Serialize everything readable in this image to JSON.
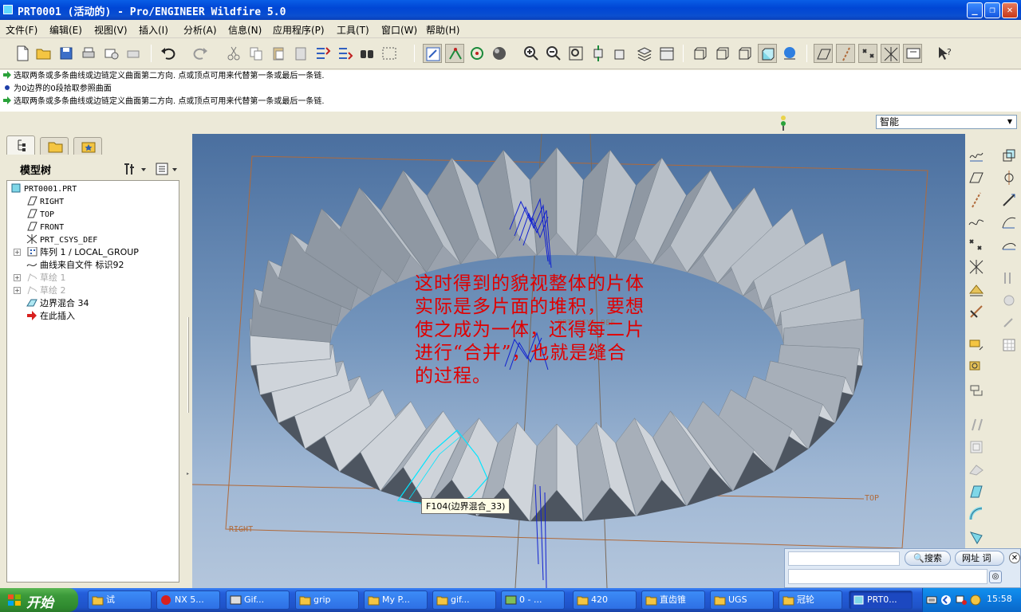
{
  "window": {
    "title": "PRT0001 (活动的) - Pro/ENGINEER Wildfire 5.0",
    "minimize": "_",
    "restore": "❐",
    "close": "✕"
  },
  "menu": [
    "文件(F)",
    "编辑(E)",
    "视图(V)",
    "插入(I)",
    "分析(A)",
    "信息(N)",
    "应用程序(P)",
    "工具(T)",
    "窗口(W)",
    "帮助(H)"
  ],
  "messages": [
    "选取两条或多条曲线或边链定义曲面第二方向. 点或顶点可用来代替第一条或最后一条链.",
    "为0边界的0段拾取参照曲面",
    "选取两条或多条曲线或边链定义曲面第二方向. 点或顶点可用来代替第一条或最后一条链."
  ],
  "filter": {
    "selected": "智能"
  },
  "model_tree": {
    "title": "模型树",
    "items": [
      {
        "label": "PRT0001.PRT",
        "icon": "part-icon"
      },
      {
        "label": "RIGHT",
        "icon": "datum-plane-icon"
      },
      {
        "label": "TOP",
        "icon": "datum-plane-icon"
      },
      {
        "label": "FRONT",
        "icon": "datum-plane-icon"
      },
      {
        "label": "PRT_CSYS_DEF",
        "icon": "csys-icon"
      },
      {
        "label": "阵列 1 / LOCAL_GROUP",
        "icon": "pattern-icon"
      },
      {
        "label": "曲线来自文件 标识92",
        "icon": "curve-icon"
      },
      {
        "label": "草绘 1",
        "icon": "sketch-icon"
      },
      {
        "label": "草绘 2",
        "icon": "sketch-icon"
      },
      {
        "label": "边界混合 34",
        "icon": "boundary-blend-icon"
      },
      {
        "label": "在此插入",
        "icon": "insert-here-icon"
      }
    ]
  },
  "viewport": {
    "annotation": [
      "这时得到的貌视整体的片体",
      "实际是多片面的堆积，要想",
      "使之成为一体，还得每二片",
      "进行“合并”，也就是缝合",
      "的过程。"
    ],
    "tooltip": "F104(边界混合_33)",
    "csys_label": "PRT_CSYS_DEF",
    "plane_top": "TOP",
    "plane_right": "RIGHT",
    "colors": {
      "annotation": "#e00000",
      "selection": "#00e5ff",
      "datum": "#b06a3a"
    }
  },
  "searchbar": {
    "search_label": "搜索",
    "web_label": "网址 词"
  },
  "taskbar": {
    "start": "开始",
    "tasks": [
      "试",
      "NX 5...",
      "Gif...",
      "grip",
      "My P...",
      "gif...",
      "0 - ...",
      "420",
      "直齿锥",
      "UGS",
      "冠轮",
      "PRT0..."
    ],
    "clock": "15:58"
  }
}
